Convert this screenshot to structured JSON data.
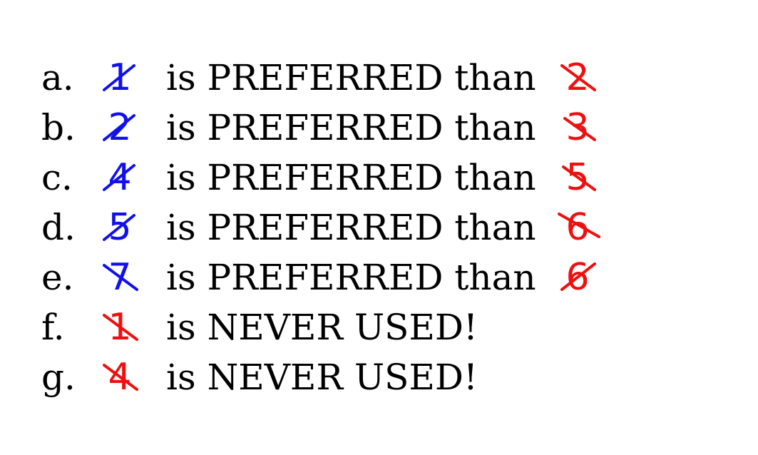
{
  "colors": {
    "preferred": "#1010ee",
    "rejected": "#ee1010",
    "text": "#000000"
  },
  "rules": [
    {
      "letter": "a.",
      "left": "1",
      "left_color": "preferred",
      "text": "is PREFERRED than",
      "right": "2",
      "right_color": "rejected"
    },
    {
      "letter": "b.",
      "left": "2",
      "left_color": "preferred",
      "text": "is PREFERRED than",
      "right": "3",
      "right_color": "rejected"
    },
    {
      "letter": "c.",
      "left": "4",
      "left_color": "preferred",
      "text": "is PREFERRED than",
      "right": "5",
      "right_color": "rejected"
    },
    {
      "letter": "d.",
      "left": "5",
      "left_color": "preferred",
      "text": "is PREFERRED than",
      "right": "6",
      "right_color": "rejected"
    },
    {
      "letter": "e.",
      "left": "7",
      "left_color": "preferred",
      "text": "is PREFERRED than",
      "right": "6",
      "right_color": "rejected"
    },
    {
      "letter": "f.",
      "left": "1",
      "left_color": "rejected",
      "text": "is NEVER USED!"
    },
    {
      "letter": "g.",
      "left": "4",
      "left_color": "rejected",
      "text": "is NEVER USED!"
    }
  ]
}
